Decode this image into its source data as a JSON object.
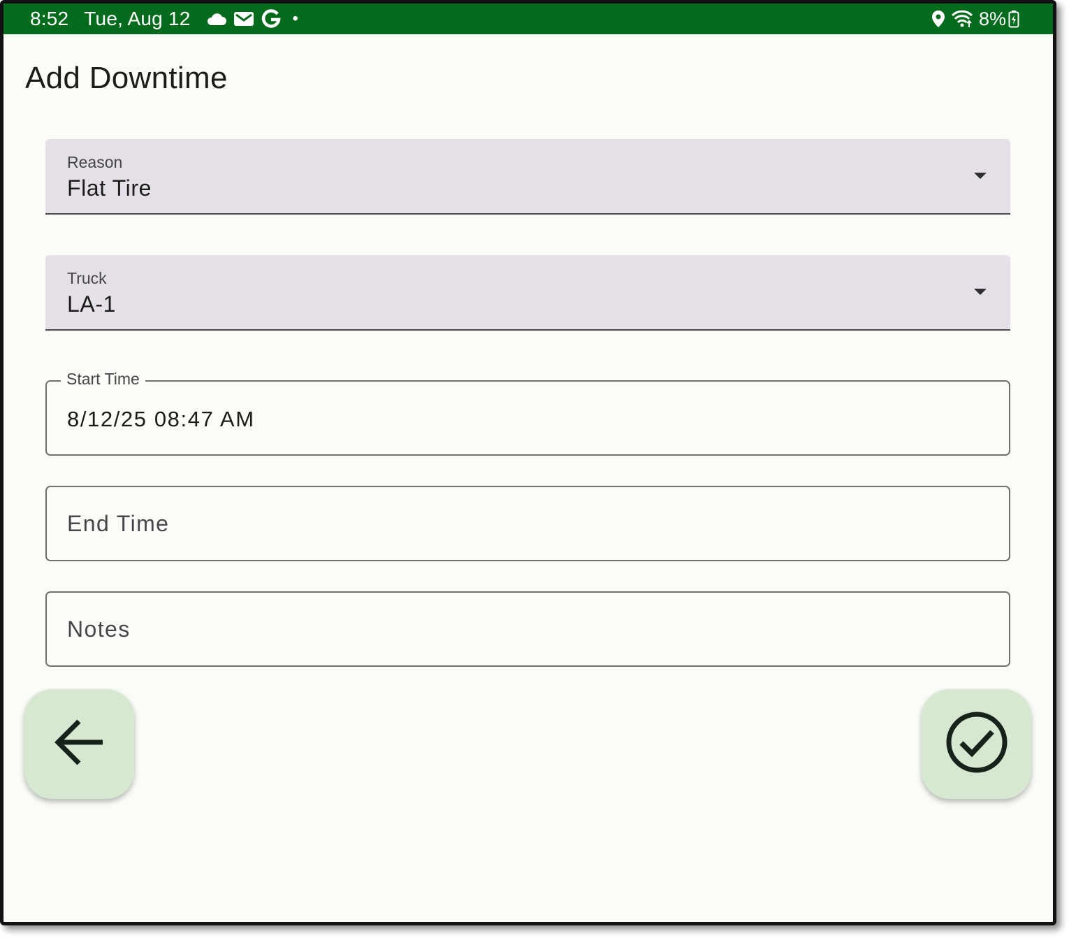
{
  "status_bar": {
    "time": "8:52",
    "date": "Tue, Aug 12",
    "notification_icons": [
      "cloud-icon",
      "gmail-icon",
      "google-icon",
      "more-notifications-dot-icon"
    ],
    "dot": "•",
    "right_icons": [
      "location-icon",
      "wifi-icon",
      "battery-charging-icon"
    ],
    "battery": "8%",
    "color": "#046b1c"
  },
  "page": {
    "title": "Add Downtime"
  },
  "form": {
    "reason": {
      "label": "Reason",
      "value": "Flat Tire"
    },
    "truck": {
      "label": "Truck",
      "value": "LA-1"
    },
    "start_time": {
      "label": "Start Time",
      "value": "8/12/25 08:47 AM"
    },
    "end_time": {
      "placeholder": "End Time"
    },
    "notes": {
      "placeholder": "Notes"
    }
  },
  "actions": {
    "back_icon": "arrow-left-icon",
    "submit_icon": "check-circle-icon",
    "fab_color": "#d6e8d0"
  }
}
